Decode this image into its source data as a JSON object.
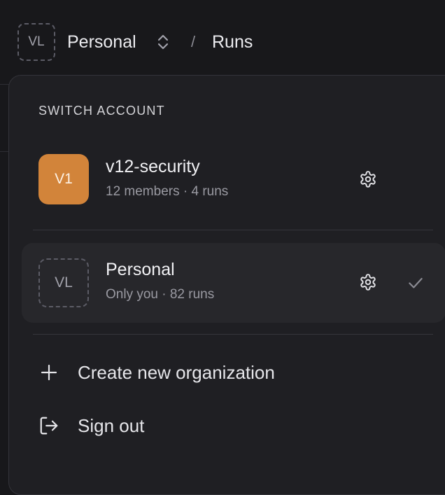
{
  "header": {
    "avatar_initials": "VL",
    "account_name": "Personal",
    "separator": "/",
    "page_title": "Runs",
    "switcher_icon": "chevron-up-down-icon"
  },
  "menu": {
    "heading": "SWITCH ACCOUNT",
    "accounts": [
      {
        "initials": "V1",
        "name": "v12-security",
        "meta": "12 members · 4 runs",
        "avatar_color": "#d2843a",
        "selected": false,
        "icons": [
          "gear-icon"
        ]
      },
      {
        "initials": "VL",
        "name": "Personal",
        "meta": "Only you · 82 runs",
        "avatar_style": "dashed",
        "selected": true,
        "icons": [
          "gear-icon",
          "check-icon"
        ]
      }
    ],
    "actions": [
      {
        "label": "Create new organization",
        "icon": "plus-icon"
      },
      {
        "label": "Sign out",
        "icon": "sign-out-icon"
      }
    ]
  },
  "colors": {
    "background": "#18181b",
    "menu_background": "#1f1f23",
    "selected_row": "#27272b",
    "accent_avatar": "#d2843a",
    "muted_text": "#9a9aa2"
  }
}
